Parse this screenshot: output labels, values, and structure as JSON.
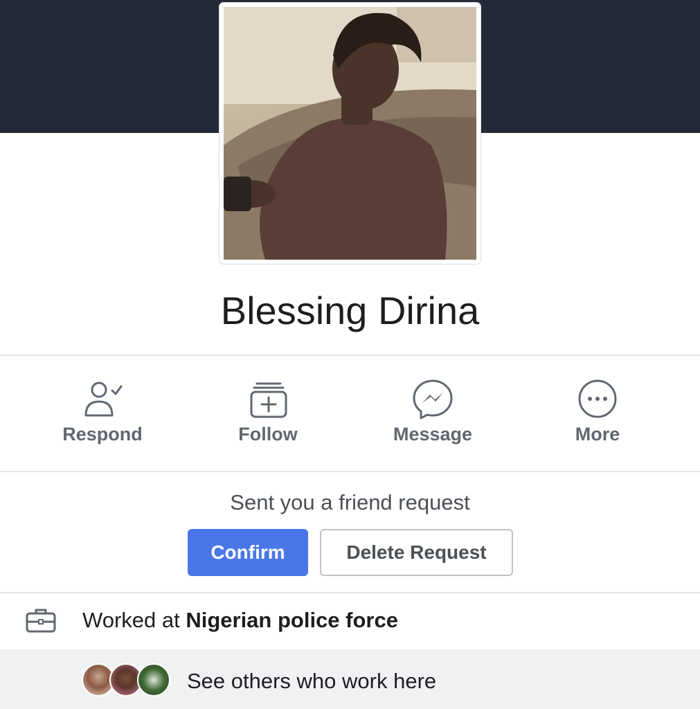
{
  "profile": {
    "name": "Blessing Dirina"
  },
  "actions": [
    {
      "label": "Respond",
      "icon": "respond-person-check-icon"
    },
    {
      "label": "Follow",
      "icon": "follow-plus-icon"
    },
    {
      "label": "Message",
      "icon": "messenger-icon"
    },
    {
      "label": "More",
      "icon": "more-dots-icon"
    }
  ],
  "friend_request": {
    "text": "Sent you a friend request",
    "confirm_label": "Confirm",
    "delete_label": "Delete Request"
  },
  "work": {
    "prefix": "Worked at ",
    "employer": "Nigerian police force",
    "icon": "briefcase-icon"
  },
  "coworkers": {
    "text": "See others who work here"
  },
  "colors": {
    "cover": "#232936",
    "confirm_button": "#4a76e8",
    "icon_gray": "#606770",
    "row_highlight": "#f0f1f3"
  }
}
